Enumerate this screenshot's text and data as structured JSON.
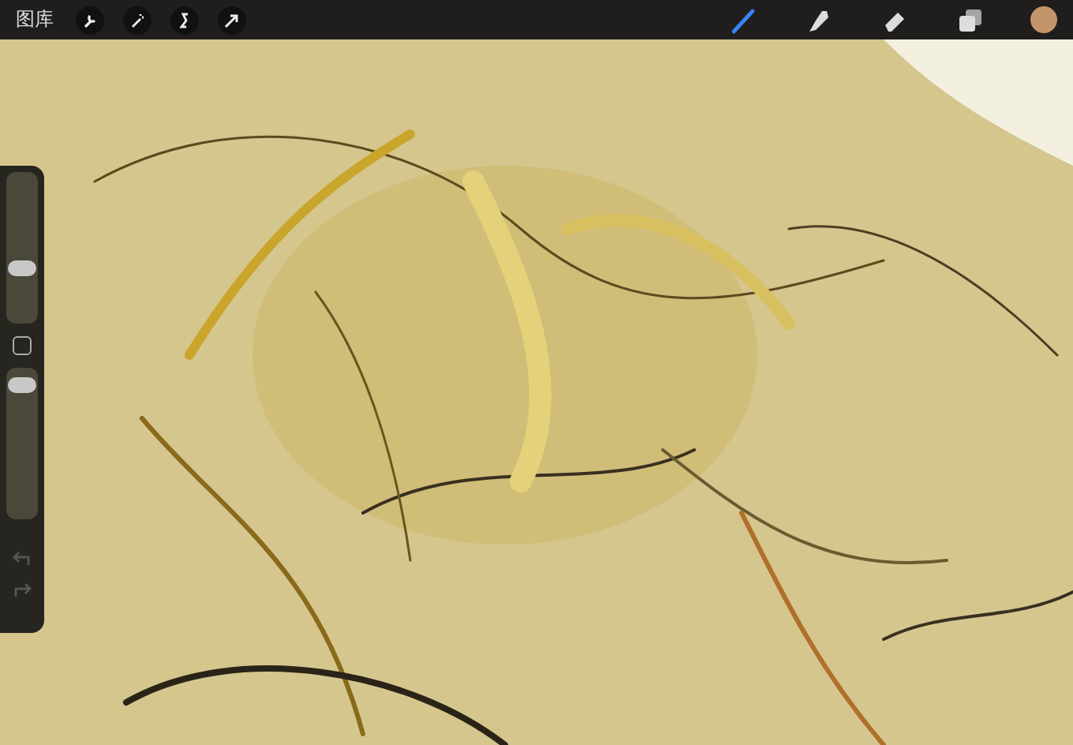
{
  "top_bar": {
    "gallery_label": "图库",
    "left_tools": [
      {
        "kind": "wrench"
      },
      {
        "kind": "wand"
      },
      {
        "kind": "select"
      },
      {
        "kind": "transform"
      }
    ],
    "right_tools": [
      {
        "kind": "brush",
        "selected": true
      },
      {
        "kind": "smudge",
        "selected": false
      },
      {
        "kind": "eraser",
        "selected": false
      },
      {
        "kind": "layers",
        "selected": false
      }
    ],
    "color": "#c4956a"
  },
  "sidebar": {
    "sliders": [
      {
        "level": 0.35
      },
      {
        "level": 0.93
      }
    ],
    "undo_disabled": true,
    "redo_disabled": true
  }
}
